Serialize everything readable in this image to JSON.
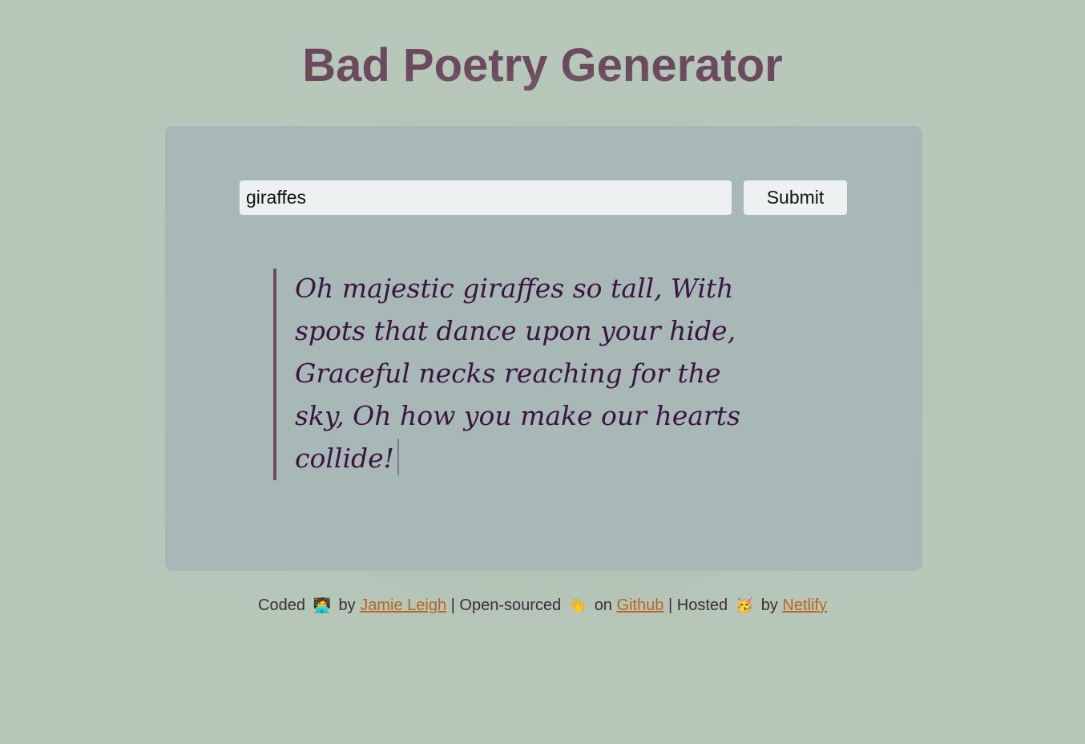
{
  "header": {
    "title": "Bad Poetry Generator"
  },
  "form": {
    "input_value": "giraffes",
    "submit_label": "Submit"
  },
  "poem": {
    "text": "Oh majestic giraffes so tall, With spots that dance upon your hide, Graceful necks reaching for the sky, Oh how you make our hearts collide!"
  },
  "footer": {
    "coded": "Coded",
    "coded_emoji": "🧑‍💻",
    "by_1": "by",
    "author_link": "Jamie Leigh",
    "sep_1": "|",
    "open_sourced": "Open-sourced",
    "open_emoji": "👋",
    "on": "on",
    "github_link": "Github",
    "sep_2": "|",
    "hosted": "Hosted",
    "hosted_emoji": "🥳",
    "by_2": "by",
    "netlify_link": "Netlify"
  },
  "colors": {
    "background": "#b7c8ba",
    "card": "#a8b8b6",
    "title": "#6c4a5e",
    "poem_text": "#3b1540",
    "link": "#b8651f"
  }
}
